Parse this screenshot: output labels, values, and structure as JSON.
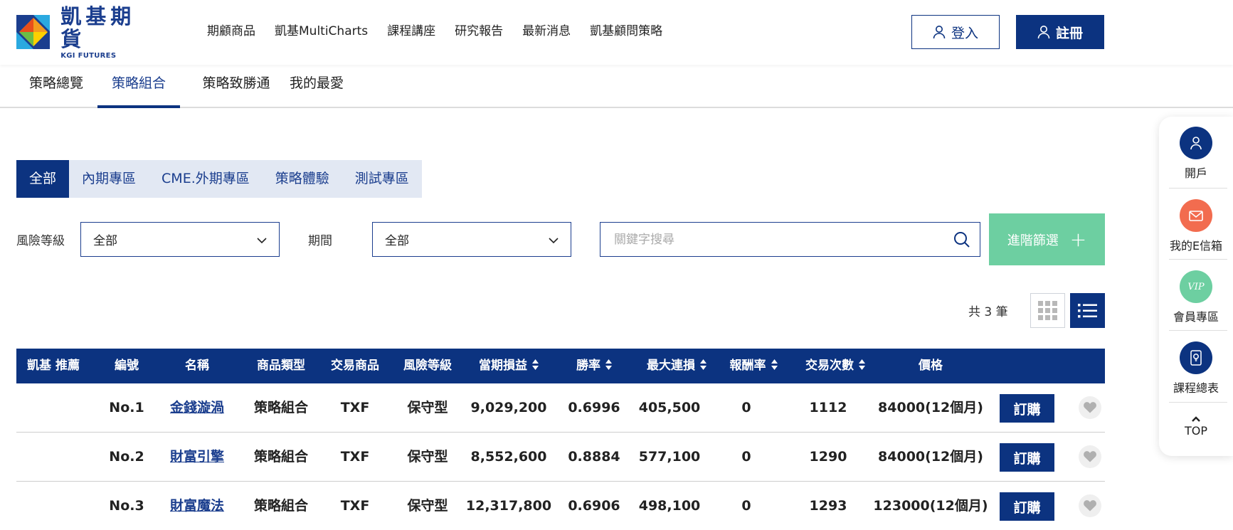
{
  "brand": {
    "name_cn": "凱基期貨",
    "name_en": "KGI FUTURES"
  },
  "nav": [
    "期顧商品",
    "凱基MultiCharts",
    "課程講座",
    "研究報告",
    "最新消息",
    "凱基顧問策略"
  ],
  "auth": {
    "login": "登入",
    "register": "註冊"
  },
  "subtabs": [
    "策略總覽",
    "策略組合",
    "策略致勝通",
    "我的最愛"
  ],
  "subtab_active": "策略組合",
  "filter_tabs": [
    "全部",
    "內期專區",
    "CME.外期專區",
    "策略體驗",
    "測試專區"
  ],
  "filters": {
    "risk_label": "風險等級",
    "risk_value": "全部",
    "period_label": "期間",
    "period_value": "全部",
    "search_placeholder": "關鍵字搜尋",
    "advanced": "進階篩選"
  },
  "count_text": "共 3 筆",
  "table": {
    "headers": [
      "凱基 推薦",
      "編號",
      "名稱",
      "商品類型",
      "交易商品",
      "風險等級",
      "當期損益",
      "勝率",
      "最大連損",
      "報酬率",
      "交易次數",
      "價格"
    ],
    "buy_label": "訂購",
    "rows": [
      {
        "no": "No.1",
        "name": "金錢漩渦",
        "type": "策略組合",
        "product": "TXF",
        "risk": "保守型",
        "pnl": "9,029,200",
        "winrate": "0.6996",
        "maxloss": "405,500",
        "roi": "0",
        "trades": "1112",
        "price": "84000(12個月)"
      },
      {
        "no": "No.2",
        "name": "財富引擎",
        "type": "策略組合",
        "product": "TXF",
        "risk": "保守型",
        "pnl": "8,552,600",
        "winrate": "0.8884",
        "maxloss": "577,100",
        "roi": "0",
        "trades": "1290",
        "price": "84000(12個月)"
      },
      {
        "no": "No.3",
        "name": "財富魔法",
        "type": "策略組合",
        "product": "TXF",
        "risk": "保守型",
        "pnl": "12,317,800",
        "winrate": "0.6906",
        "maxloss": "498,100",
        "roi": "0",
        "trades": "1293",
        "price": "123000(12個月)"
      }
    ]
  },
  "float": {
    "open_account": "開戶",
    "mailbox": "我的E信箱",
    "vip_badge": "VIP",
    "member": "會員專區",
    "courses": "課程總表",
    "top": "TOP"
  },
  "colors": {
    "primary": "#0c3380",
    "accent_green": "#6dcfa1",
    "mail_orange": "#f26c4f",
    "vip_green": "#6dcfa1"
  }
}
